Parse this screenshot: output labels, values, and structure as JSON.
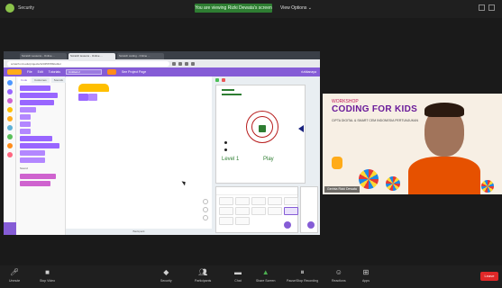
{
  "topbar": {
    "meeting_label": "Security",
    "viewing_text": "You are viewing Rizki Dewata's screen",
    "view_options_label": "View Options ⌄"
  },
  "browser": {
    "tabs": [
      "Scratch Lessons - Online ...",
      "Scratch lessons - Online ...",
      "Scratch coding - Online ...",
      "..."
    ],
    "url": "scratch.mit.edu/projects/123456789/editor"
  },
  "scratch": {
    "menu": [
      "File",
      "Edit",
      "Tutorials"
    ],
    "project_title": "Untitled-2",
    "share_label": "Share",
    "see_project_label": "See Project Page",
    "user_label": "rizkitanaya",
    "palette_tabs": [
      "Code",
      "Costumes",
      "Sounds"
    ],
    "palette_heading": "Sound",
    "backpack_label": "Backpack",
    "categories": [
      "Motion",
      "Looks",
      "Sound",
      "Events",
      "Control",
      "Sensing",
      "Operators",
      "Variables",
      "My Blocks"
    ],
    "stage_level_text": "Level 1",
    "stage_play_text": "Play"
  },
  "video": {
    "workshop_label": "WORKSHOP",
    "headline": "CODING FOR KIDS",
    "subtitle": "CIPTA DIGITAL & SMART CEM INDONESIA PERTUNJUKAN",
    "participant_name": "Gerinta Rizki Dewata"
  },
  "toolbar": {
    "items": [
      {
        "label": "Unmute",
        "icon": "mic-icon"
      },
      {
        "label": "Stop Video",
        "icon": "video-icon"
      },
      {
        "label": "Security",
        "icon": "shield-icon"
      },
      {
        "label": "Participants",
        "icon": "participants-icon"
      },
      {
        "label": "Chat",
        "icon": "chat-icon"
      },
      {
        "label": "Share Screen",
        "icon": "share-screen-icon"
      },
      {
        "label": "Pause/Stop Recording",
        "icon": "record-icon"
      },
      {
        "label": "Reactions",
        "icon": "reactions-icon"
      },
      {
        "label": "Apps",
        "icon": "apps-icon"
      }
    ],
    "leave_label": "Leave"
  },
  "colors": {
    "scratch_purple": "#855cd6",
    "viewing_green": "#2e7d32",
    "leave_red": "#e02828"
  }
}
